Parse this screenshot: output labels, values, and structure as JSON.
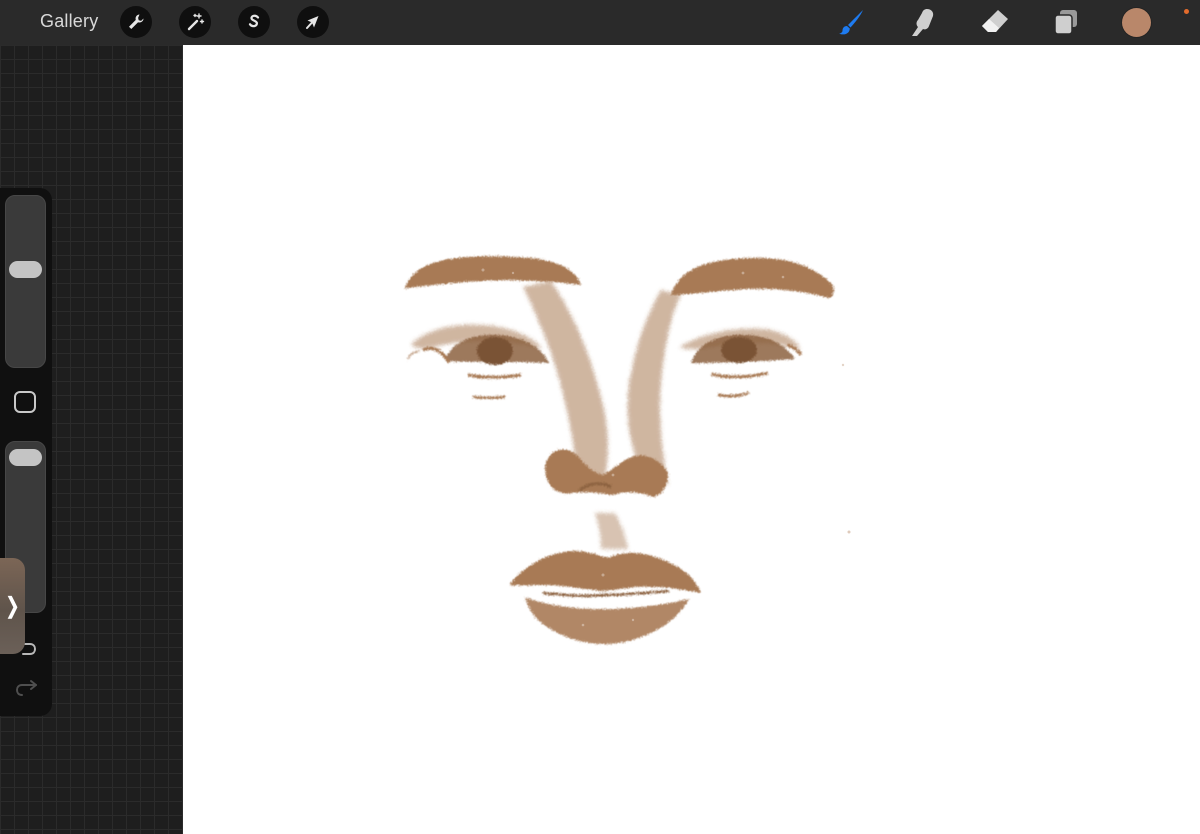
{
  "toolbar": {
    "gallery_label": "Gallery",
    "left_tools": [
      {
        "name": "actions",
        "icon": "wrench-icon"
      },
      {
        "name": "adjustments",
        "icon": "magic-wand-icon"
      },
      {
        "name": "selection",
        "icon": "selection-s-icon"
      },
      {
        "name": "transform",
        "icon": "arrow-cursor-icon"
      }
    ],
    "right_tools": [
      {
        "name": "brush",
        "icon": "brush-icon",
        "active": true
      },
      {
        "name": "smudge",
        "icon": "smudge-finger-icon"
      },
      {
        "name": "eraser",
        "icon": "eraser-icon"
      },
      {
        "name": "layers",
        "icon": "layers-icon"
      }
    ],
    "active_color": "#b9876a",
    "accent_color": "#1e7bf0",
    "notification_color": "#e36b2c"
  },
  "sidebar": {
    "brush_size_level": 0.58,
    "opacity_level": 0.97,
    "modifier_icon": "square-modifier-icon",
    "undo_icon": "undo-arrow-icon",
    "redo_icon": "redo-arrow-icon",
    "reference_tab_glyph": "❭"
  },
  "canvas": {
    "background": "#ffffff",
    "sketch_color": "#a87a55",
    "content": "sketch-face"
  }
}
